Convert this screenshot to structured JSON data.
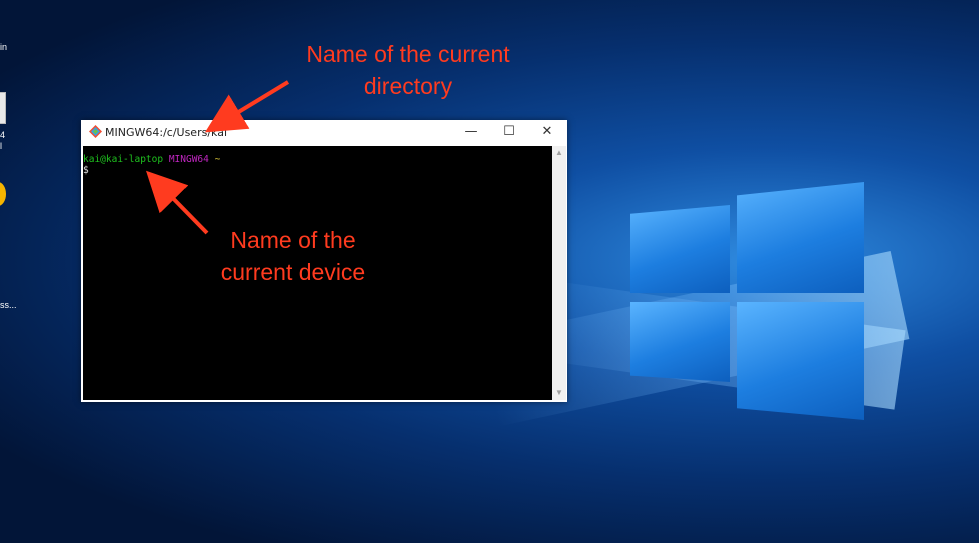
{
  "desktop": {
    "icons": [
      {
        "label": "in",
        "icon": "desktop-shortcut-icon"
      },
      {
        "label": "4\nl",
        "icon": "desktop-file-icon"
      },
      {
        "label": "",
        "icon": "desktop-app-icon"
      },
      {
        "label": "ss...",
        "icon": "desktop-shortcut-icon"
      }
    ]
  },
  "window": {
    "title": "MINGW64:/c/Users/kai",
    "icon": "git-bash-icon",
    "minimize": "—",
    "maximize": "☐",
    "close": "✕"
  },
  "console": {
    "user_host": "kai@kai-laptop",
    "env": "MINGW64",
    "path": "~",
    "prompt": "$",
    "colors": {
      "user_host": "#1fc21f",
      "env": "#c026c0",
      "path": "#d8c53a",
      "prompt": "#e0e0e0"
    }
  },
  "annotations": {
    "directory": "Name of the current directory",
    "device": "Name of the current device",
    "color": "#ff3b1f"
  }
}
